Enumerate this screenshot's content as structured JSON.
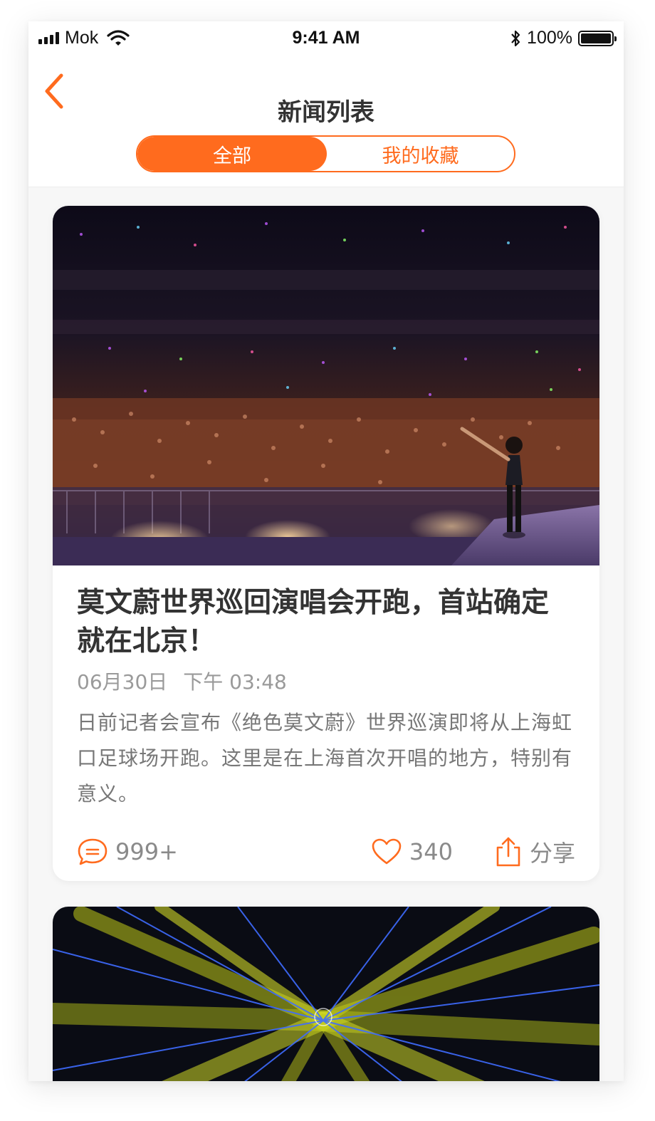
{
  "status_bar": {
    "carrier": "Mok",
    "time": "9:41 AM",
    "battery": "100%"
  },
  "nav": {
    "title": "新闻列表",
    "back_icon": "chevron-left-icon"
  },
  "tabs": [
    {
      "label": "全部",
      "active": true
    },
    {
      "label": "我的收藏",
      "active": false
    }
  ],
  "colors": {
    "accent": "#ff6b1e",
    "text_dark": "#333333",
    "text_muted": "#9a9a9a"
  },
  "articles": [
    {
      "title": "莫文蔚世界巡回演唱会开跑，首站确定就在北京！",
      "date": "06月30日",
      "time": "下午 03:48",
      "summary": "日前记者会宣布《绝色莫文蔚》世界巡演即将从上海虹口足球场开跑。这里是在上海首次开唱的地方，特别有意义。",
      "comments": "999+",
      "likes": "340",
      "share_label": "分享"
    }
  ]
}
